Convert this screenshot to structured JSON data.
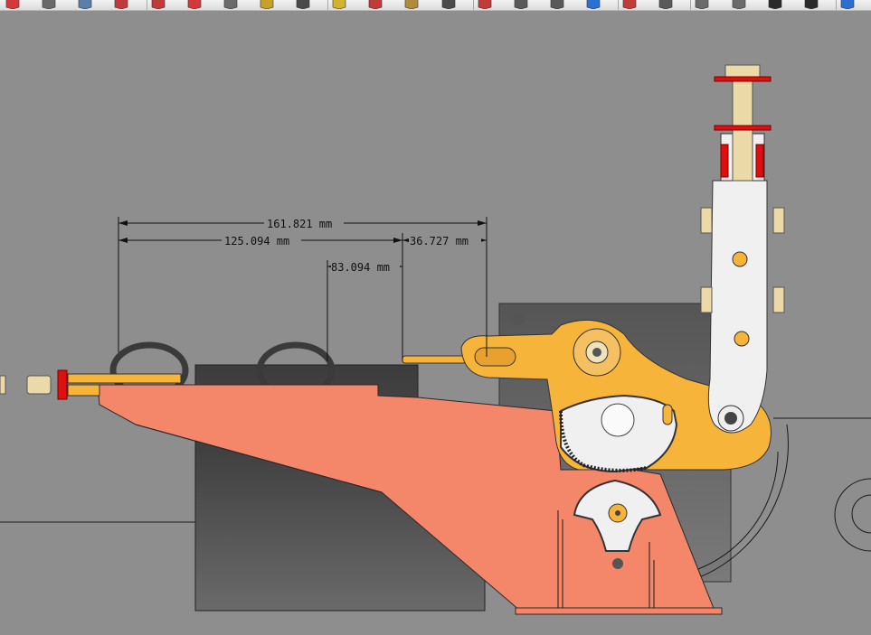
{
  "app": {
    "view": "sketch-viewport"
  },
  "toolbar": {
    "buttons": [
      {
        "id": "tb-1",
        "icon": "undo-icon",
        "color": "#d23a3a"
      },
      {
        "id": "tb-2",
        "icon": "camera-icon",
        "color": "#6a6a6a"
      },
      {
        "id": "tb-3",
        "icon": "pencil-icon",
        "color": "#5b7fa8"
      },
      {
        "id": "tb-4",
        "icon": "arc-icon",
        "color": "#c23b3b"
      },
      {
        "id": "tb-5",
        "icon": "push-pull-icon",
        "color": "#c23b3b"
      },
      {
        "id": "tb-6",
        "icon": "rotate-icon",
        "color": "#d23a3a"
      },
      {
        "id": "tb-7",
        "icon": "box-icon",
        "color": "#6a6a6a"
      },
      {
        "id": "tb-8",
        "icon": "paint-icon",
        "color": "#c8a12a"
      },
      {
        "id": "tb-9",
        "icon": "pin-icon",
        "color": "#4a4a4a"
      },
      {
        "id": "tb-10",
        "icon": "tape-icon",
        "color": "#d2b42c"
      },
      {
        "id": "tb-11",
        "icon": "orbit-icon",
        "color": "#c23b3b"
      },
      {
        "id": "tb-12",
        "icon": "pan-icon",
        "color": "#b08c3a"
      },
      {
        "id": "tb-13",
        "icon": "walk-icon",
        "color": "#4a4a4a"
      },
      {
        "id": "tb-14",
        "icon": "zoom-extents-icon",
        "color": "#c23b3b"
      },
      {
        "id": "tb-15",
        "icon": "section-icon",
        "color": "#5a5a5a"
      },
      {
        "id": "tb-16",
        "icon": "camera-position-icon",
        "color": "#5a5a5a"
      },
      {
        "id": "tb-17",
        "icon": "arrow-right-icon",
        "color": "#2b6fd1"
      },
      {
        "id": "tb-18",
        "icon": "settings-icon",
        "color": "#c23b3b"
      },
      {
        "id": "tb-19",
        "icon": "soccer-ball-icon",
        "color": "#5a5a5a"
      },
      {
        "id": "tb-20",
        "icon": "iso-view-icon",
        "color": "#6a6a6a"
      },
      {
        "id": "tb-21",
        "icon": "top-view-icon",
        "color": "#6a6a6a"
      },
      {
        "id": "tb-22",
        "icon": "front-view-icon",
        "color": "#2a2a2a"
      },
      {
        "id": "tb-23",
        "icon": "right-view-icon",
        "color": "#2a2a2a"
      },
      {
        "id": "tb-24",
        "icon": "back-view-icon",
        "color": "#2b6fd1"
      }
    ]
  },
  "dimensions": [
    {
      "id": "dim-total",
      "text": "161.821 mm"
    },
    {
      "id": "dim-left",
      "text": "125.094 mm"
    },
    {
      "id": "dim-right",
      "text": "36.727 mm"
    },
    {
      "id": "dim-mid",
      "text": "83.094 mm"
    }
  ],
  "colors": {
    "background": "#8e8e8e",
    "salmon_part": "#f4866a",
    "orange_arm": "#f7b43b",
    "white_link": "#f0f0f0",
    "dark_block": "#4b4b4b",
    "red_nut": "#e00f0f",
    "beige_bolt": "#ecd9a8"
  }
}
